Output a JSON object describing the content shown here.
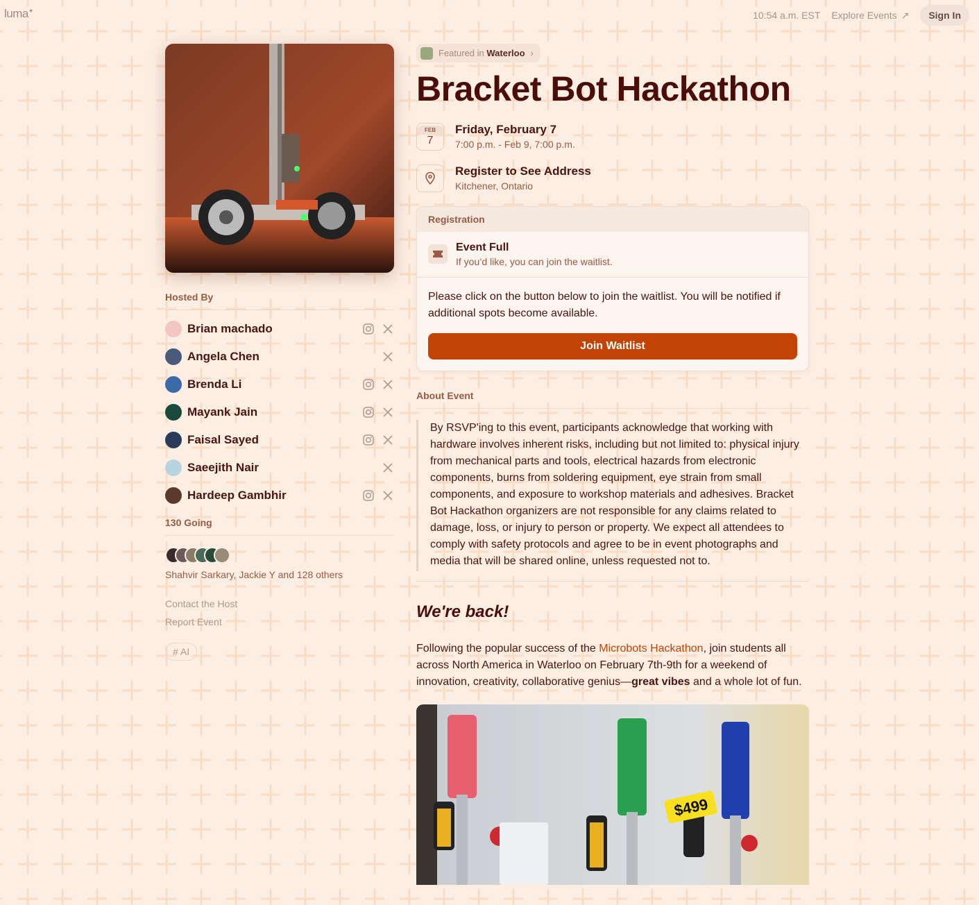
{
  "topbar": {
    "logo": "luma",
    "time": "10:54 a.m. EST",
    "explore_label": "Explore Events",
    "signin_label": "Sign In"
  },
  "sidebar": {
    "hosted_by_label": "Hosted By",
    "hosts": [
      {
        "name": "Brian machado",
        "instagram": true,
        "x": true
      },
      {
        "name": "Angela Chen",
        "instagram": false,
        "x": true
      },
      {
        "name": "Brenda Li",
        "instagram": true,
        "x": true
      },
      {
        "name": "Mayank Jain",
        "instagram": true,
        "x": true
      },
      {
        "name": "Faisal Sayed",
        "instagram": true,
        "x": true
      },
      {
        "name": "Saeejith Nair",
        "instagram": false,
        "x": true
      },
      {
        "name": "Hardeep Gambhir",
        "instagram": true,
        "x": true
      }
    ],
    "going_label": "130 Going",
    "going_names": "Shahvir Sarkary, Jackie Y and 128 others",
    "contact_label": "Contact the Host",
    "report_label": "Report Event",
    "tag_label": "# AI"
  },
  "event": {
    "featured_prefix": "Featured in",
    "featured_city": "Waterloo",
    "title": "Bracket Bot Hackathon",
    "date_month": "FEB",
    "date_day": "7",
    "date_line": "Friday, February 7",
    "time_line": "7:00 p.m. - Feb 9, 7:00 p.m.",
    "location_title": "Register to See Address",
    "location_sub": "Kitchener, Ontario"
  },
  "registration": {
    "header": "Registration",
    "status_title": "Event Full",
    "status_sub": "If you’d like, you can join the waitlist.",
    "body": "Please click on the button below to join the waitlist. You will be notified if additional spots become available.",
    "button_label": "Join Waitlist"
  },
  "about": {
    "label": "About Event",
    "disclaimer": "By RSVP'ing to this event, participants acknowledge that working with hardware involves inherent risks, including but not limited to: physical injury from mechanical parts and tools, electrical hazards from electronic components, burns from soldering equipment, eye strain from small components, and exposure to workshop materials and adhesives. Bracket Bot Hackathon organizers are not responsible for any claims related to damage, loss, or injury to person or property. We expect all attendees to comply with safety protocols and agree to be in event photographs and media that will be shared online, unless requested not to.",
    "heading": "We're back!",
    "para_start": "Following the popular success of the ",
    "para_link": "Microbots Hackathon",
    "para_mid": ", join students all across North America in Waterloo on February 7th-9th for a weekend of innovation, creativity, collaborative genius—",
    "para_bold": "great vibes",
    "para_end": " and a whole lot of fun.",
    "price_tag": "$499"
  },
  "colors": {
    "accent": "#c24304",
    "background": "#fdeee3",
    "title": "#4a0d0a"
  }
}
